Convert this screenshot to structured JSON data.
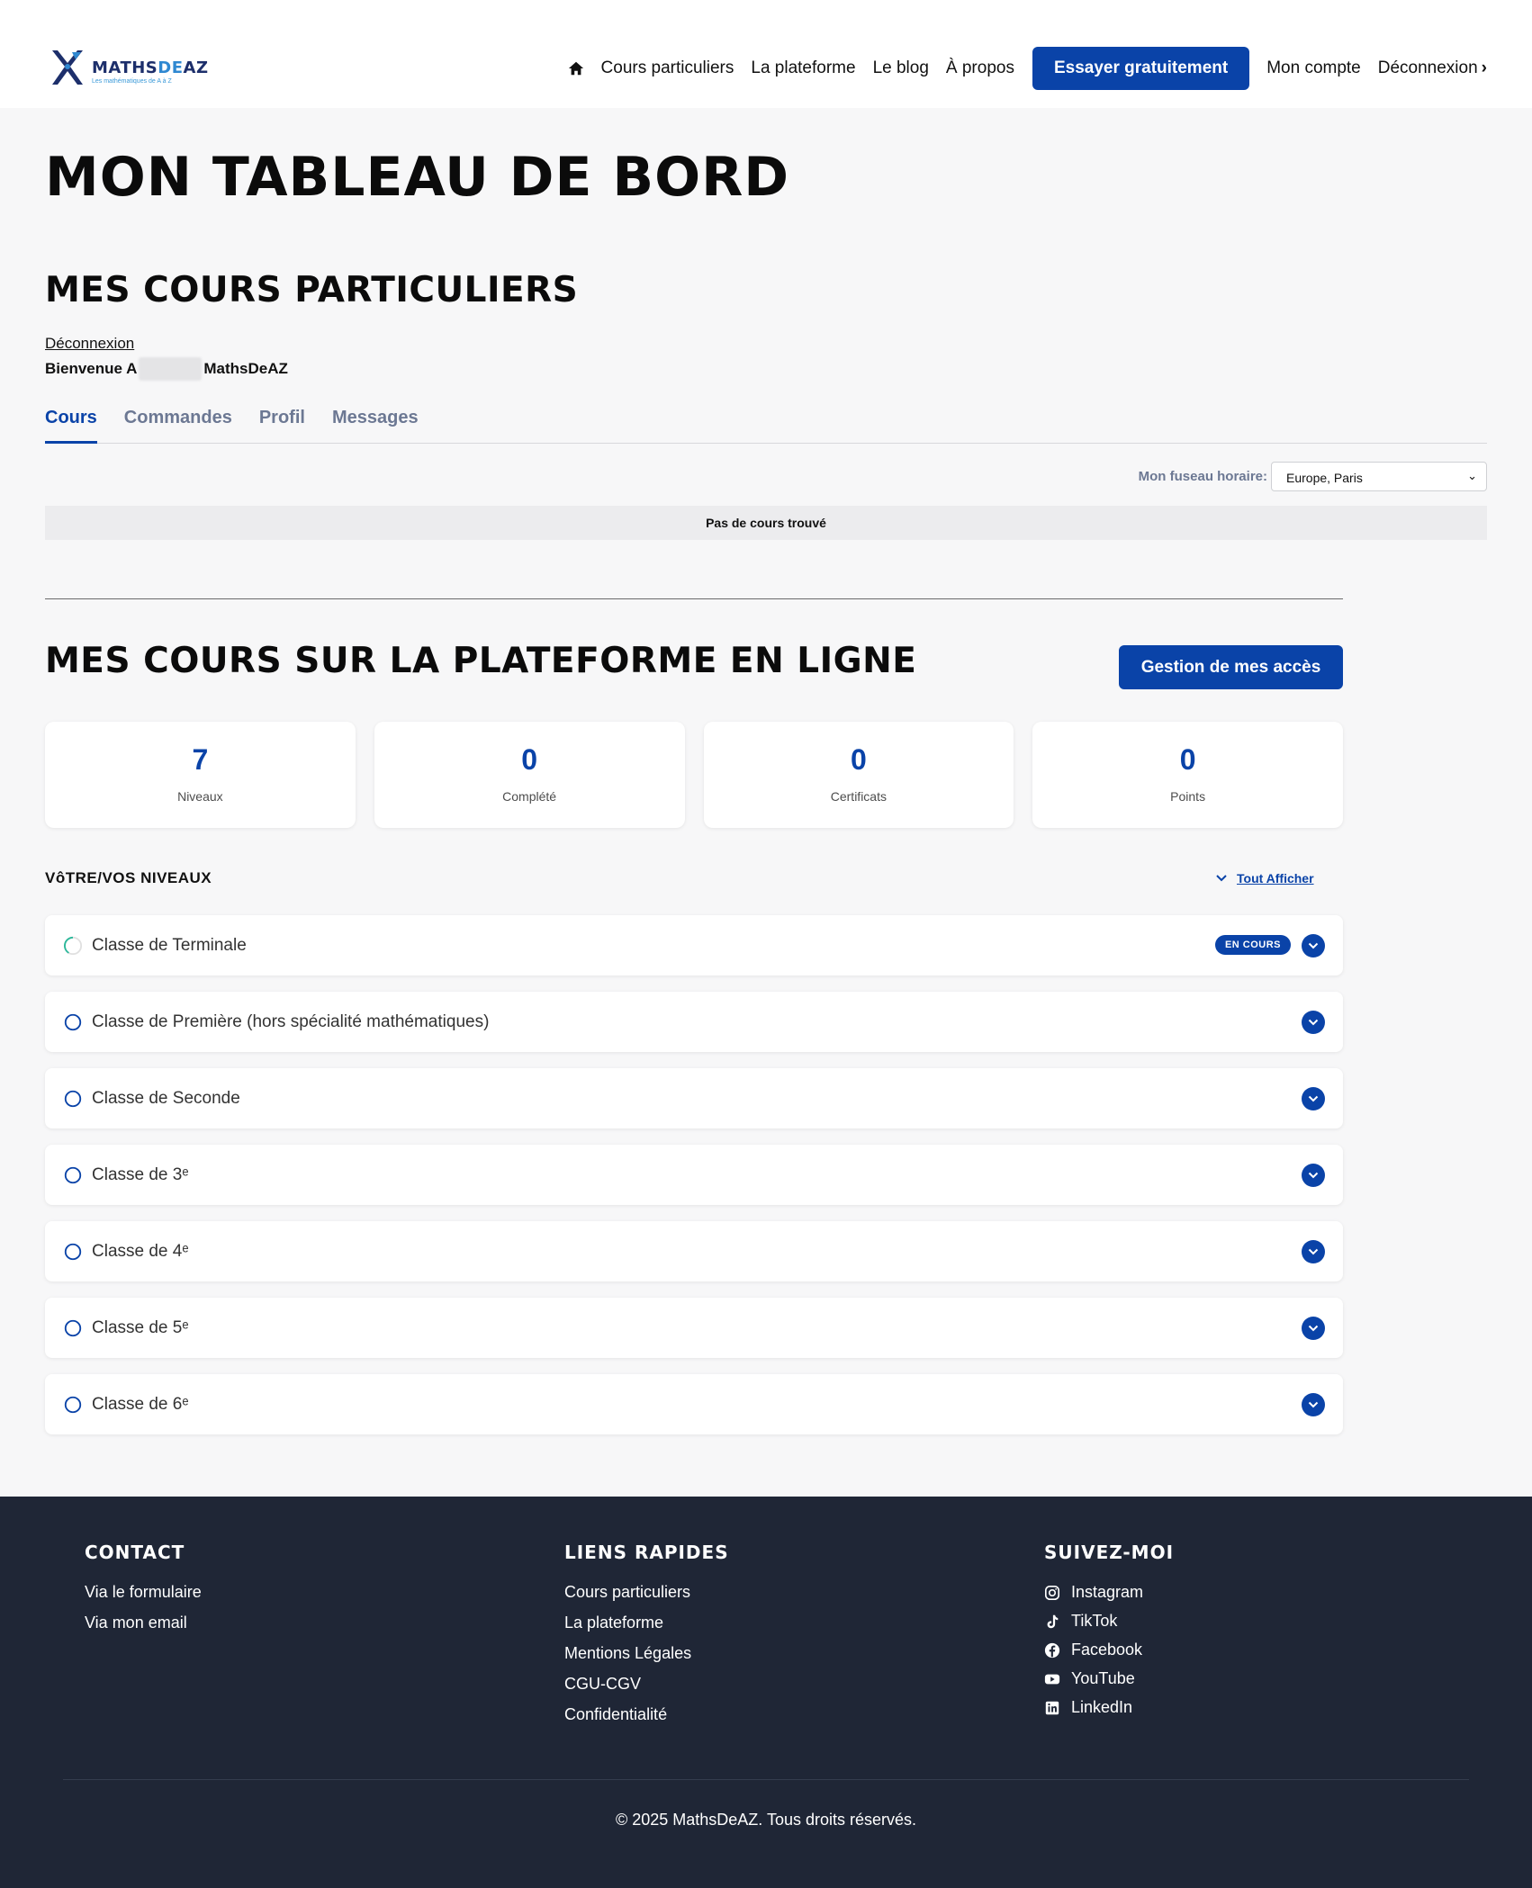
{
  "header": {
    "logo_text_main": "MATHS",
    "logo_text_de": "DE",
    "logo_text_az": "AZ",
    "logo_tagline": "Les mathématiques de A à Z",
    "nav": [
      "Cours particuliers",
      "La plateforme",
      "Le blog",
      "À propos"
    ],
    "cta": "Essayer gratuitement",
    "account": "Mon compte",
    "logout": "Déconnexion"
  },
  "page_title": "MON TABLEAU DE BORD",
  "private": {
    "title": "MES COURS PARTICULIERS",
    "logout_link": "Déconnexion",
    "welcome_prefix": "Bienvenue A",
    "welcome_suffix": "MathsDeAZ",
    "tabs": [
      "Cours",
      "Commandes",
      "Profil",
      "Messages"
    ],
    "timezone_label": "Mon fuseau horaire:",
    "timezone_value": "Europe, Paris",
    "empty": "Pas de cours trouvé"
  },
  "platform": {
    "title": "MES COURS SUR LA PLATEFORME EN LIGNE",
    "access_button": "Gestion de mes accès",
    "stats": [
      {
        "value": "7",
        "label": "Niveaux"
      },
      {
        "value": "0",
        "label": "Complété"
      },
      {
        "value": "0",
        "label": "Certificats"
      },
      {
        "value": "0",
        "label": "Points"
      }
    ],
    "levels_heading": "VôTRE/VOS NIVEAUX",
    "show_all": "Tout Afficher",
    "levels": [
      {
        "name": "Classe de Terminale",
        "badge": "EN COURS",
        "status": "in-progress"
      },
      {
        "name": "Classe de Première (hors spécialité mathématiques)",
        "status": "not-started"
      },
      {
        "name": "Classe de Seconde",
        "status": "not-started"
      },
      {
        "name": "Classe de 3ᵉ",
        "status": "not-started"
      },
      {
        "name": "Classe de 4ᵉ",
        "status": "not-started"
      },
      {
        "name": "Classe de 5ᵉ",
        "status": "not-started"
      },
      {
        "name": "Classe de 6ᵉ",
        "status": "not-started"
      }
    ]
  },
  "footer": {
    "contact_title": "CONTACT",
    "contact_links": [
      "Via le formulaire",
      "Via mon email"
    ],
    "quick_title": "LIENS RAPIDES",
    "quick_links": [
      "Cours particuliers",
      "La plateforme",
      "Mentions Légales",
      "CGU-CGV",
      "Confidentialité"
    ],
    "social_title": "SUIVEZ-MOI",
    "social_links": [
      {
        "label": "Instagram",
        "icon": "instagram-icon"
      },
      {
        "label": "TikTok",
        "icon": "tiktok-icon"
      },
      {
        "label": "Facebook",
        "icon": "facebook-icon"
      },
      {
        "label": "YouTube",
        "icon": "youtube-icon"
      },
      {
        "label": "LinkedIn",
        "icon": "linkedin-icon"
      }
    ],
    "copyright": "© 2025 MathsDeAZ. Tous droits réservés."
  },
  "colors": {
    "primary": "#0a43a8",
    "footer_bg": "#1f2636",
    "progress_ring": "#2bb89a"
  }
}
